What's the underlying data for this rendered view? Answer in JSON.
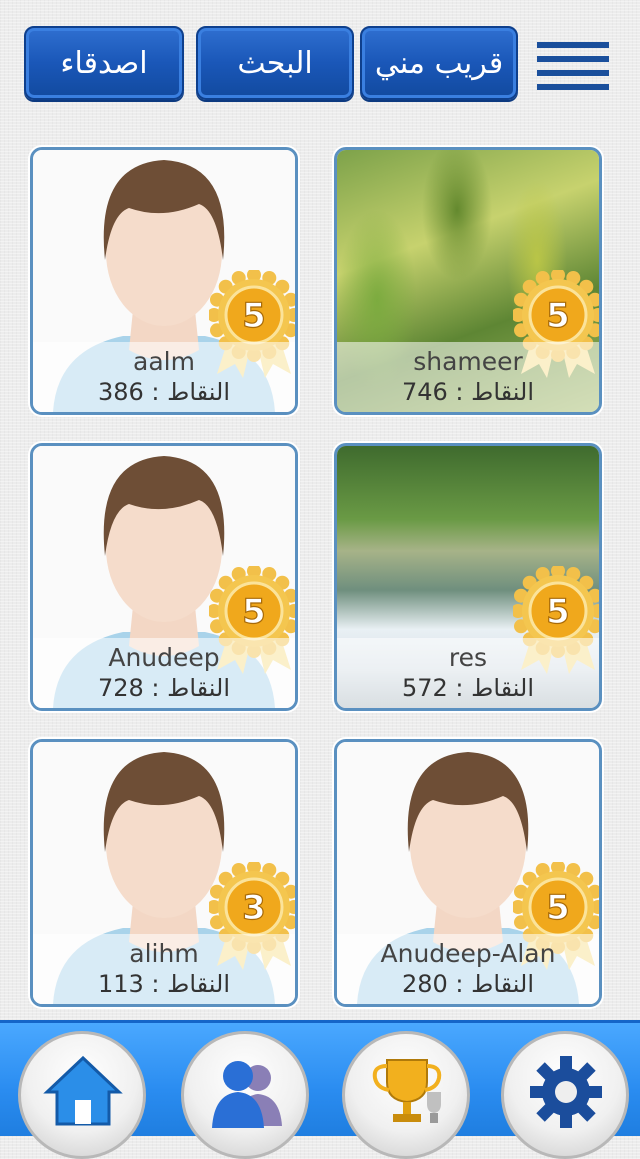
{
  "header": {
    "friends_label": "اصدقاء",
    "search_label": "البحث",
    "near_label": "قريب مني"
  },
  "cards": [
    {
      "name": "shameer",
      "points": "النقاط : 746",
      "badge": "5",
      "photo": "leaves"
    },
    {
      "name": "aalm",
      "points": "النقاط : 386",
      "badge": "5",
      "photo": "avatar"
    },
    {
      "name": "res",
      "points": "النقاط : 572",
      "badge": "5",
      "photo": "river"
    },
    {
      "name": "Anudeep",
      "points": "النقاط : 728",
      "badge": "5",
      "photo": "avatar"
    },
    {
      "name": "Anudeep-Alan",
      "points": "النقاط : 280",
      "badge": "5",
      "photo": "avatar"
    },
    {
      "name": "alihm",
      "points": "النقاط : 113",
      "badge": "3",
      "photo": "avatar"
    }
  ],
  "colors": {
    "accent": "#1a57b8",
    "card_border": "#5a90c0",
    "bottom_bar": "#2a8cf0",
    "medal_gold": "#f2b01e"
  },
  "nav": {
    "icons": [
      "home-icon",
      "friends-icon",
      "trophy-icon",
      "settings-icon"
    ]
  }
}
